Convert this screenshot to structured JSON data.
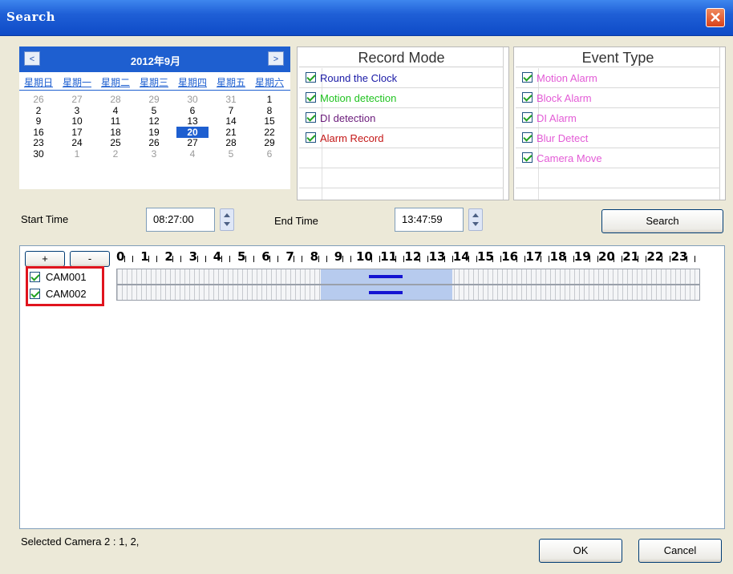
{
  "window": {
    "title": "Search",
    "close_glyph": "✕"
  },
  "calendar": {
    "prev": "<",
    "next": ">",
    "month": "2012年9月",
    "weekdays": [
      "星期日",
      "星期一",
      "星期二",
      "星期三",
      "星期四",
      "星期五",
      "星期六"
    ],
    "weeks": [
      [
        "26",
        "27",
        "28",
        "29",
        "30",
        "31",
        "1"
      ],
      [
        "2",
        "3",
        "4",
        "5",
        "6",
        "7",
        "8"
      ],
      [
        "9",
        "10",
        "11",
        "12",
        "13",
        "14",
        "15"
      ],
      [
        "16",
        "17",
        "18",
        "19",
        "20",
        "21",
        "22"
      ],
      [
        "23",
        "24",
        "25",
        "26",
        "27",
        "28",
        "29"
      ],
      [
        "30",
        "1",
        "2",
        "3",
        "4",
        "5",
        "6"
      ]
    ],
    "selected_day": "20"
  },
  "record_mode": {
    "header": "Record Mode",
    "items": [
      {
        "label": "Round the Clock",
        "color": "#1a1aa6",
        "checked": true
      },
      {
        "label": "Motion detection",
        "color": "#22c322",
        "checked": true
      },
      {
        "label": "DI detection",
        "color": "#6a1a7a",
        "checked": true
      },
      {
        "label": "Alarm Record",
        "color": "#c41818",
        "checked": true
      }
    ]
  },
  "event_type": {
    "header": "Event Type",
    "items": [
      {
        "label": "Motion Alarm",
        "color": "#e35bd6",
        "checked": true
      },
      {
        "label": "Block Alarm",
        "color": "#e35bd6",
        "checked": true
      },
      {
        "label": "DI Alarm",
        "color": "#e35bd6",
        "checked": true
      },
      {
        "label": "Blur Detect",
        "color": "#e35bd6",
        "checked": true
      },
      {
        "label": "Camera Move",
        "color": "#e35bd6",
        "checked": true
      }
    ]
  },
  "time": {
    "start_label": "Start Time",
    "start_value": "08:27:00",
    "end_label": "End Time",
    "end_value": "13:47:59",
    "search_button": "Search"
  },
  "timeline": {
    "zoom_in": "+",
    "zoom_out": "-",
    "hours": [
      "0",
      "1",
      "2",
      "3",
      "4",
      "5",
      "6",
      "7",
      "8",
      "9",
      "10",
      "11",
      "12",
      "13",
      "14",
      "15",
      "16",
      "17",
      "18",
      "19",
      "20",
      "21",
      "22",
      "23"
    ],
    "cameras": [
      {
        "name": "CAM001",
        "checked": true
      },
      {
        "name": "CAM002",
        "checked": true
      }
    ]
  },
  "status": "Selected Camera 2 : 1, 2,",
  "buttons": {
    "ok": "OK",
    "cancel": "Cancel"
  }
}
